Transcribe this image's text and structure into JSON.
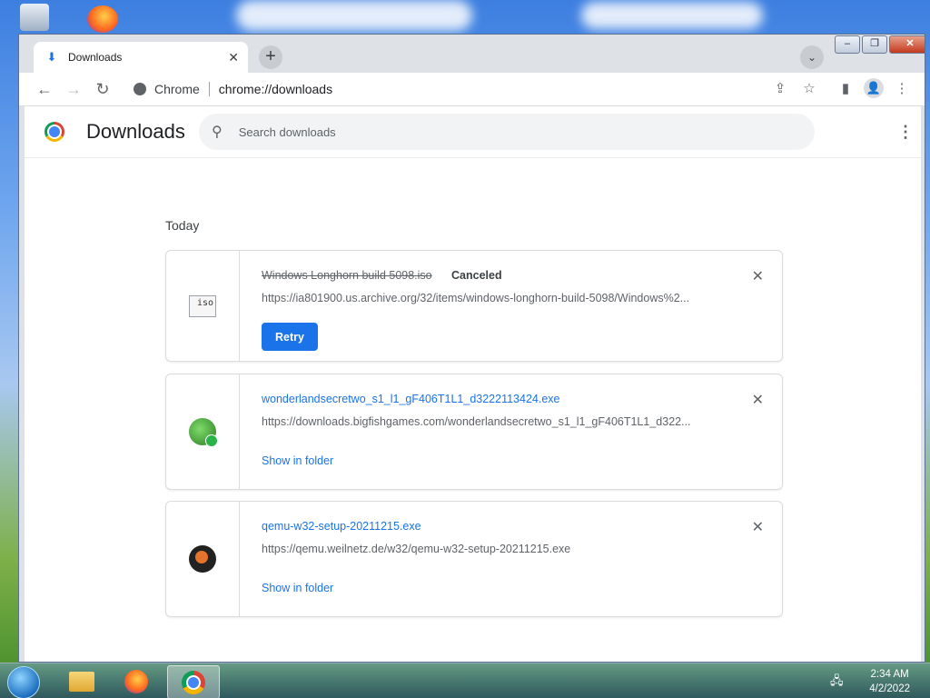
{
  "window": {
    "tab_title": "Downloads",
    "tab_close": "✕",
    "new_tab": "+",
    "tab_search": "⌄",
    "controls": {
      "minimize": "–",
      "maximize": "❐",
      "close": "✕"
    }
  },
  "toolbar": {
    "back": "←",
    "forward": "→",
    "reload": "↻",
    "site_chip": "Chrome",
    "url": "chrome://downloads",
    "share": "⇪",
    "bookmark": "☆",
    "side_panel": "▮",
    "profile": "👤",
    "menu": "⋮"
  },
  "downloads": {
    "title": "Downloads",
    "search_placeholder": "Search downloads",
    "search_icon": "⚲",
    "menu": "⋮",
    "section_label": "Today",
    "items": [
      {
        "filename": "Windows Longhorn build 5098.iso",
        "status": "Canceled",
        "url": "https://ia801900.us.archive.org/32/items/windows-longhorn-build-5098/Windows%2...",
        "action": "Retry",
        "icon": "iso-file-icon",
        "icon_text": "iso",
        "remove": "✕"
      },
      {
        "filename": "wonderlandsecretwo_s1_l1_gF406T1L1_d3222113424.exe",
        "url": "https://downloads.bigfishgames.com/wonderlandsecretwo_s1_l1_gF406T1L1_d322...",
        "action": "Show in folder",
        "icon": "bigfish-installer-icon",
        "remove": "✕"
      },
      {
        "filename": "qemu-w32-setup-20211215.exe",
        "url": "https://qemu.weilnetz.de/w32/qemu-w32-setup-20211215.exe",
        "action": "Show in folder",
        "icon": "qemu-installer-icon",
        "remove": "✕"
      }
    ]
  },
  "taskbar": {
    "time": "2:34 AM",
    "date": "4/2/2022",
    "network_icon": "🖧"
  },
  "colors": {
    "accent": "#1a73e8",
    "chrome_frame": "#dee1e6"
  }
}
